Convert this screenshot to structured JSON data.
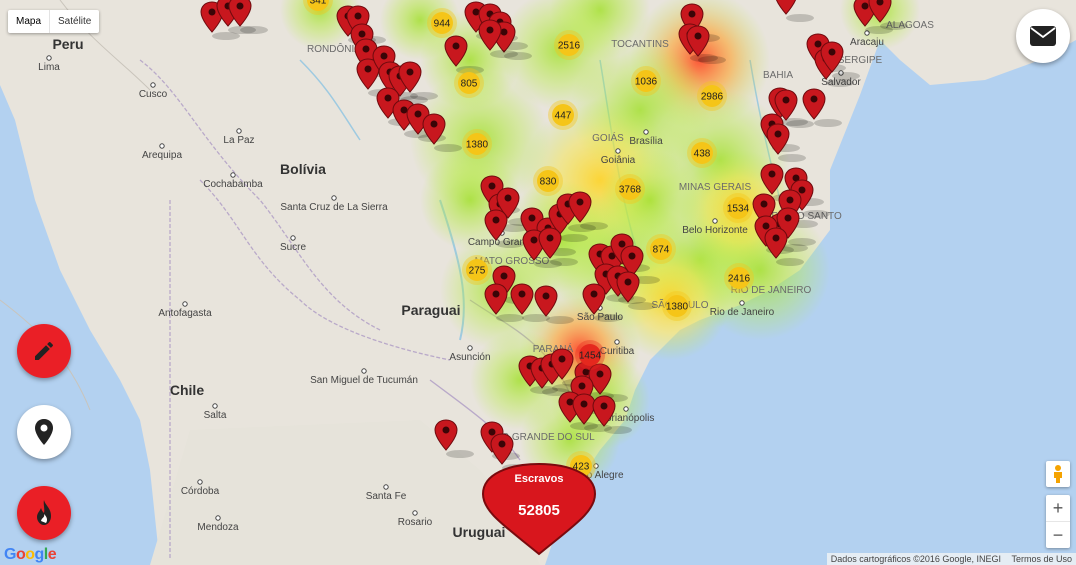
{
  "map_type": {
    "map": "Mapa",
    "satellite": "Satélite",
    "selected": "map"
  },
  "colors": {
    "water": "#b3d1f0",
    "land": "#e8e4dc",
    "border": "#b9a9c9",
    "marker": "#c8171e",
    "fab_red": "#ea1f26",
    "cluster": "#f5c518"
  },
  "country_labels": [
    "Peru",
    "Bolívia",
    "Paraguai",
    "Chile",
    "Uruguai"
  ],
  "state_labels": [
    "RONDÔNIA",
    "TOCANTINS",
    "BAHIA",
    "SERGIPE",
    "GOIÁS",
    "MINAS GERAIS",
    "MATO GROSSO",
    "SÃO PAULO",
    "PARANÁ",
    "ESPÍRITO SANTO",
    "RIO DE JANEIRO",
    "RIO GRANDE DO SUL",
    "ALAGOAS",
    "Brasil"
  ],
  "city_labels": [
    "Lima",
    "Cusco",
    "Arequipa",
    "La Paz",
    "Cochabamba",
    "Santa Cruz de La Sierra",
    "Sucre",
    "Antofagasta",
    "Salta",
    "San Miguel de Tucumán",
    "Asunción",
    "Córdoba",
    "Santa Fe",
    "Rosario",
    "Mendoza",
    "Brasília",
    "Goiânia",
    "Belo Horizonte",
    "Rio de Janeiro",
    "São Paulo",
    "Curitiba",
    "Florianópolis",
    "Porto Alegre",
    "Salvador",
    "Aracaju",
    "Campo Grande"
  ],
  "clusters": [
    "341",
    "944",
    "2516",
    "805",
    "1036",
    "2986",
    "447",
    "1380",
    "438",
    "830",
    "3768",
    "1534",
    "874",
    "275",
    "2416",
    "1380",
    "1454",
    "423"
  ],
  "total": {
    "title": "Escravos",
    "value": "52805"
  },
  "buttons": {
    "edit": "pencil-icon",
    "location": "map-pin-icon",
    "fire": "flame-icon",
    "mail": "mail-icon"
  },
  "zoom": {
    "in": "+",
    "out": "−"
  },
  "attribution": {
    "data": "Dados cartográficos ©2016 Google, INEGI",
    "terms": "Termos de Uso"
  },
  "logo": "Google"
}
